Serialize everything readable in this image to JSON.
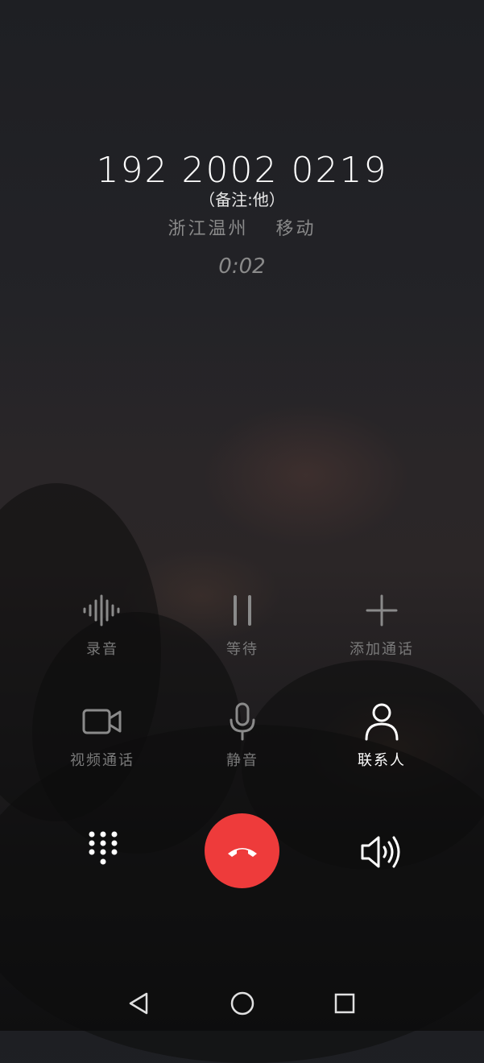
{
  "call": {
    "number": "192 2002 0219",
    "remark": "（备注:他）",
    "location_region": "浙江温州",
    "location_carrier": "移动",
    "duration": "0:02"
  },
  "actions": {
    "record": {
      "label": "录音",
      "icon": "waveform-icon"
    },
    "hold": {
      "label": "等待",
      "icon": "pause-icon"
    },
    "add_call": {
      "label": "添加通话",
      "icon": "plus-icon"
    },
    "video_call": {
      "label": "视频通话",
      "icon": "video-camera-icon"
    },
    "mute": {
      "label": "静音",
      "icon": "microphone-icon"
    },
    "contacts": {
      "label": "联系人",
      "icon": "person-icon"
    }
  },
  "controls": {
    "dialpad": {
      "icon": "dialpad-icon"
    },
    "hangup": {
      "icon": "hangup-phone-icon",
      "color": "#ee3b3b"
    },
    "speaker": {
      "icon": "speaker-icon"
    }
  },
  "navbar": {
    "back": {
      "icon": "back-triangle-icon"
    },
    "home": {
      "icon": "home-circle-icon"
    },
    "recents": {
      "icon": "recents-square-icon"
    }
  }
}
